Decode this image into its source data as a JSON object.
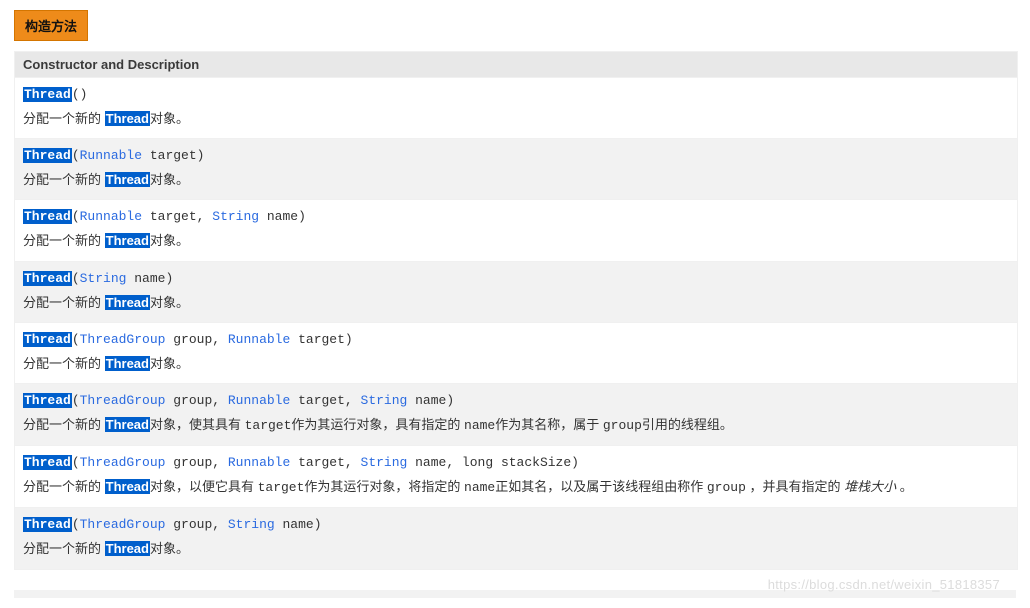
{
  "header_button": "构造方法",
  "table_header": "Constructor and Description",
  "thread_label": "Thread",
  "watermark": "https://blog.csdn.net/weixin_51818357",
  "constructors": [
    {
      "sig_parts": [
        {
          "t": "hl",
          "v": "Thread"
        },
        {
          "t": "plain",
          "v": "() "
        }
      ],
      "desc_parts": [
        {
          "t": "plain",
          "v": "分配一个新的 "
        },
        {
          "t": "hl",
          "v": "Thread"
        },
        {
          "t": "plain",
          "v": "对象。"
        }
      ]
    },
    {
      "sig_parts": [
        {
          "t": "hl",
          "v": "Thread"
        },
        {
          "t": "plain",
          "v": "("
        },
        {
          "t": "type",
          "v": "Runnable"
        },
        {
          "t": "plain",
          "v": " target) "
        }
      ],
      "desc_parts": [
        {
          "t": "plain",
          "v": "分配一个新的 "
        },
        {
          "t": "hl",
          "v": "Thread"
        },
        {
          "t": "plain",
          "v": "对象。"
        }
      ]
    },
    {
      "sig_parts": [
        {
          "t": "hl",
          "v": "Thread"
        },
        {
          "t": "plain",
          "v": "("
        },
        {
          "t": "type",
          "v": "Runnable"
        },
        {
          "t": "plain",
          "v": " target, "
        },
        {
          "t": "type",
          "v": "String"
        },
        {
          "t": "plain",
          "v": " name) "
        }
      ],
      "desc_parts": [
        {
          "t": "plain",
          "v": "分配一个新的 "
        },
        {
          "t": "hl",
          "v": "Thread"
        },
        {
          "t": "plain",
          "v": "对象。"
        }
      ]
    },
    {
      "sig_parts": [
        {
          "t": "hl",
          "v": "Thread"
        },
        {
          "t": "plain",
          "v": "("
        },
        {
          "t": "type",
          "v": "String"
        },
        {
          "t": "plain",
          "v": " name) "
        }
      ],
      "desc_parts": [
        {
          "t": "plain",
          "v": "分配一个新的 "
        },
        {
          "t": "hl",
          "v": "Thread"
        },
        {
          "t": "plain",
          "v": "对象。"
        }
      ]
    },
    {
      "sig_parts": [
        {
          "t": "hl",
          "v": "Thread"
        },
        {
          "t": "plain",
          "v": "("
        },
        {
          "t": "type",
          "v": "ThreadGroup"
        },
        {
          "t": "plain",
          "v": " group, "
        },
        {
          "t": "type",
          "v": "Runnable"
        },
        {
          "t": "plain",
          "v": " target) "
        }
      ],
      "desc_parts": [
        {
          "t": "plain",
          "v": "分配一个新的 "
        },
        {
          "t": "hl",
          "v": "Thread"
        },
        {
          "t": "plain",
          "v": "对象。"
        }
      ]
    },
    {
      "sig_parts": [
        {
          "t": "hl",
          "v": "Thread"
        },
        {
          "t": "plain",
          "v": "("
        },
        {
          "t": "type",
          "v": "ThreadGroup"
        },
        {
          "t": "plain",
          "v": " group, "
        },
        {
          "t": "type",
          "v": "Runnable"
        },
        {
          "t": "plain",
          "v": " target, "
        },
        {
          "t": "type",
          "v": "String"
        },
        {
          "t": "plain",
          "v": " name) "
        }
      ],
      "desc_parts": [
        {
          "t": "plain",
          "v": "分配一个新的 "
        },
        {
          "t": "hl",
          "v": "Thread"
        },
        {
          "t": "plain",
          "v": "对象，使其具有 "
        },
        {
          "t": "code",
          "v": "target"
        },
        {
          "t": "plain",
          "v": "作为其运行对象，具有指定的 "
        },
        {
          "t": "code",
          "v": "name"
        },
        {
          "t": "plain",
          "v": "作为其名称，属于 "
        },
        {
          "t": "code",
          "v": "group"
        },
        {
          "t": "plain",
          "v": "引用的线程组。"
        }
      ]
    },
    {
      "sig_parts": [
        {
          "t": "hl",
          "v": "Thread"
        },
        {
          "t": "plain",
          "v": "("
        },
        {
          "t": "type",
          "v": "ThreadGroup"
        },
        {
          "t": "plain",
          "v": " group, "
        },
        {
          "t": "type",
          "v": "Runnable"
        },
        {
          "t": "plain",
          "v": " target, "
        },
        {
          "t": "type",
          "v": "String"
        },
        {
          "t": "plain",
          "v": " name, long stackSize) "
        }
      ],
      "desc_parts": [
        {
          "t": "plain",
          "v": "分配一个新的 "
        },
        {
          "t": "hl",
          "v": "Thread"
        },
        {
          "t": "plain",
          "v": "对象，以便它具有 "
        },
        {
          "t": "code",
          "v": "target"
        },
        {
          "t": "plain",
          "v": "作为其运行对象，将指定的 "
        },
        {
          "t": "code",
          "v": "name"
        },
        {
          "t": "plain",
          "v": "正如其名，以及属于该线程组由称作 "
        },
        {
          "t": "code",
          "v": "group"
        },
        {
          "t": "plain",
          "v": " ，并具有指定的 "
        },
        {
          "t": "italic",
          "v": "堆栈大小"
        },
        {
          "t": "plain",
          "v": " 。"
        }
      ]
    },
    {
      "sig_parts": [
        {
          "t": "hl",
          "v": "Thread"
        },
        {
          "t": "plain",
          "v": "("
        },
        {
          "t": "type",
          "v": "ThreadGroup"
        },
        {
          "t": "plain",
          "v": " group, "
        },
        {
          "t": "type",
          "v": "String"
        },
        {
          "t": "plain",
          "v": " name) "
        }
      ],
      "desc_parts": [
        {
          "t": "plain",
          "v": "分配一个新的 "
        },
        {
          "t": "hl",
          "v": "Thread"
        },
        {
          "t": "plain",
          "v": "对象。"
        }
      ]
    }
  ]
}
